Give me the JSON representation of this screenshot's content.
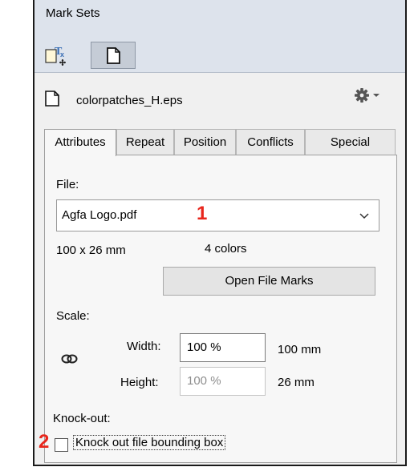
{
  "panel": {
    "title": "Mark Sets",
    "file_name": "colorpatches_H.eps",
    "tabs": [
      "Attributes",
      "Repeat",
      "Position",
      "Conflicts",
      "Special"
    ],
    "active_tab": "Attributes"
  },
  "attributes": {
    "file_label": "File:",
    "file_value": "Agfa Logo.pdf",
    "dimensions": "100 x 26 mm",
    "colors": "4 colors",
    "open_button": "Open File Marks",
    "scale_label": "Scale:",
    "width_label": "Width:",
    "width_value": "100 %",
    "width_mm": "100 mm",
    "height_label": "Height:",
    "height_value": "100 %",
    "height_mm": "26 mm",
    "knockout_label": "Knock-out:",
    "knockout_checkbox": "Knock out file bounding box",
    "knockout_checked": false
  },
  "annotations": {
    "one": "1",
    "two": "2"
  },
  "colors": {
    "annotation": "#e8261c",
    "titlebar": "#dde3ec"
  },
  "icons": [
    "add-text-mark-icon",
    "file-mark-icon",
    "document-icon",
    "gear-icon",
    "chevron-down-icon",
    "link-icon"
  ]
}
